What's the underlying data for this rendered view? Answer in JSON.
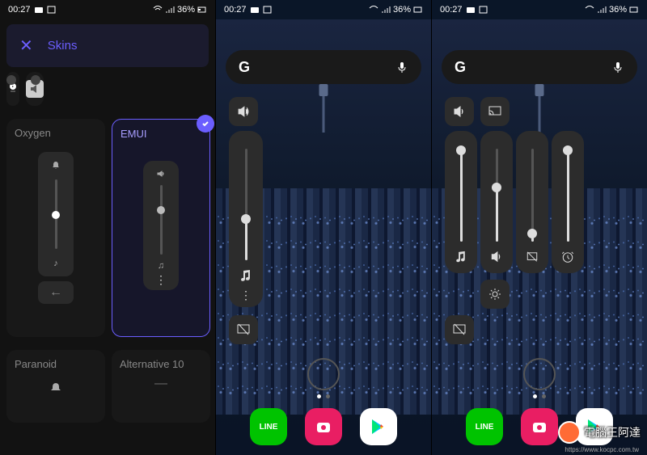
{
  "status": {
    "time": "00:27",
    "battery": "36%"
  },
  "app": {
    "header": "Skins"
  },
  "skins": {
    "prev1": "",
    "prev2": "",
    "oxygen": "Oxygen",
    "emui": "EMUI",
    "paranoid": "Paranoid",
    "alt10": "Alternative 10",
    "slider_icons": {
      "bell": "🔔",
      "note": "♫",
      "vol": "🔊",
      "more": "⋮",
      "back": "←"
    }
  },
  "search": {
    "label": "G"
  },
  "vol2": {
    "main_level": 0.35,
    "music": "♫"
  },
  "vol3": {
    "s1": 0.95,
    "s2": 0.55,
    "s3": 0.05,
    "s4": 0.95,
    "icons": {
      "music": "♫",
      "vol": "🔊",
      "mute": "🔇",
      "alarm": "⏰",
      "gear": "⚙"
    }
  },
  "dock": {
    "line": "LINE",
    "cam": "●",
    "play": "▶"
  },
  "watermark": {
    "text": "電腦王阿達",
    "url": "https://www.kocpc.com.tw"
  }
}
